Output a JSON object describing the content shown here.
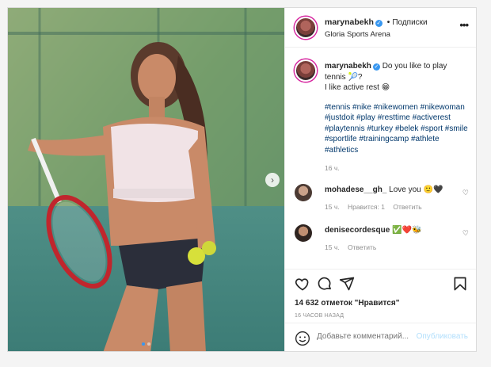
{
  "header": {
    "username": "marynabekh",
    "separator": "•",
    "follow_label": "Подписки",
    "location": "Gloria Sports Arena",
    "more_label": "•••"
  },
  "caption": {
    "username": "marynabekh",
    "text": "Do you like to play tennis 🎾?",
    "line2": "I like active rest 😁",
    "hashtags": "#tennis #nike #nikewomen #nikewoman #justdoit #play #resttime #activerest #playtennis #turkey #belek #sport #smile #sportlife #trainingcamp #athlete #athletics",
    "time": "16 ч."
  },
  "comments": [
    {
      "username": "mohadese__gh_",
      "text": "Love you 🙂🖤",
      "time": "15 ч.",
      "likes": "Нравится: 1",
      "reply": "Ответить"
    },
    {
      "username": "denisecordesque",
      "text": "✅❤️🐝",
      "time": "15 ч.",
      "reply": "Ответить"
    }
  ],
  "actions": {
    "likes_text": "14 632 отметок \"Нравится\"",
    "posted_ago": "16 ЧАСОВ НАЗАД"
  },
  "composer": {
    "placeholder": "Добавьте комментарий...",
    "post_label": "Опубликовать"
  },
  "carousel": {
    "next_icon": "chevron-right-icon",
    "slide_count": 2,
    "active_slide": 1
  },
  "colors": {
    "link": "#00376b",
    "accent": "#3897f0",
    "muted": "#8e8e8e"
  }
}
